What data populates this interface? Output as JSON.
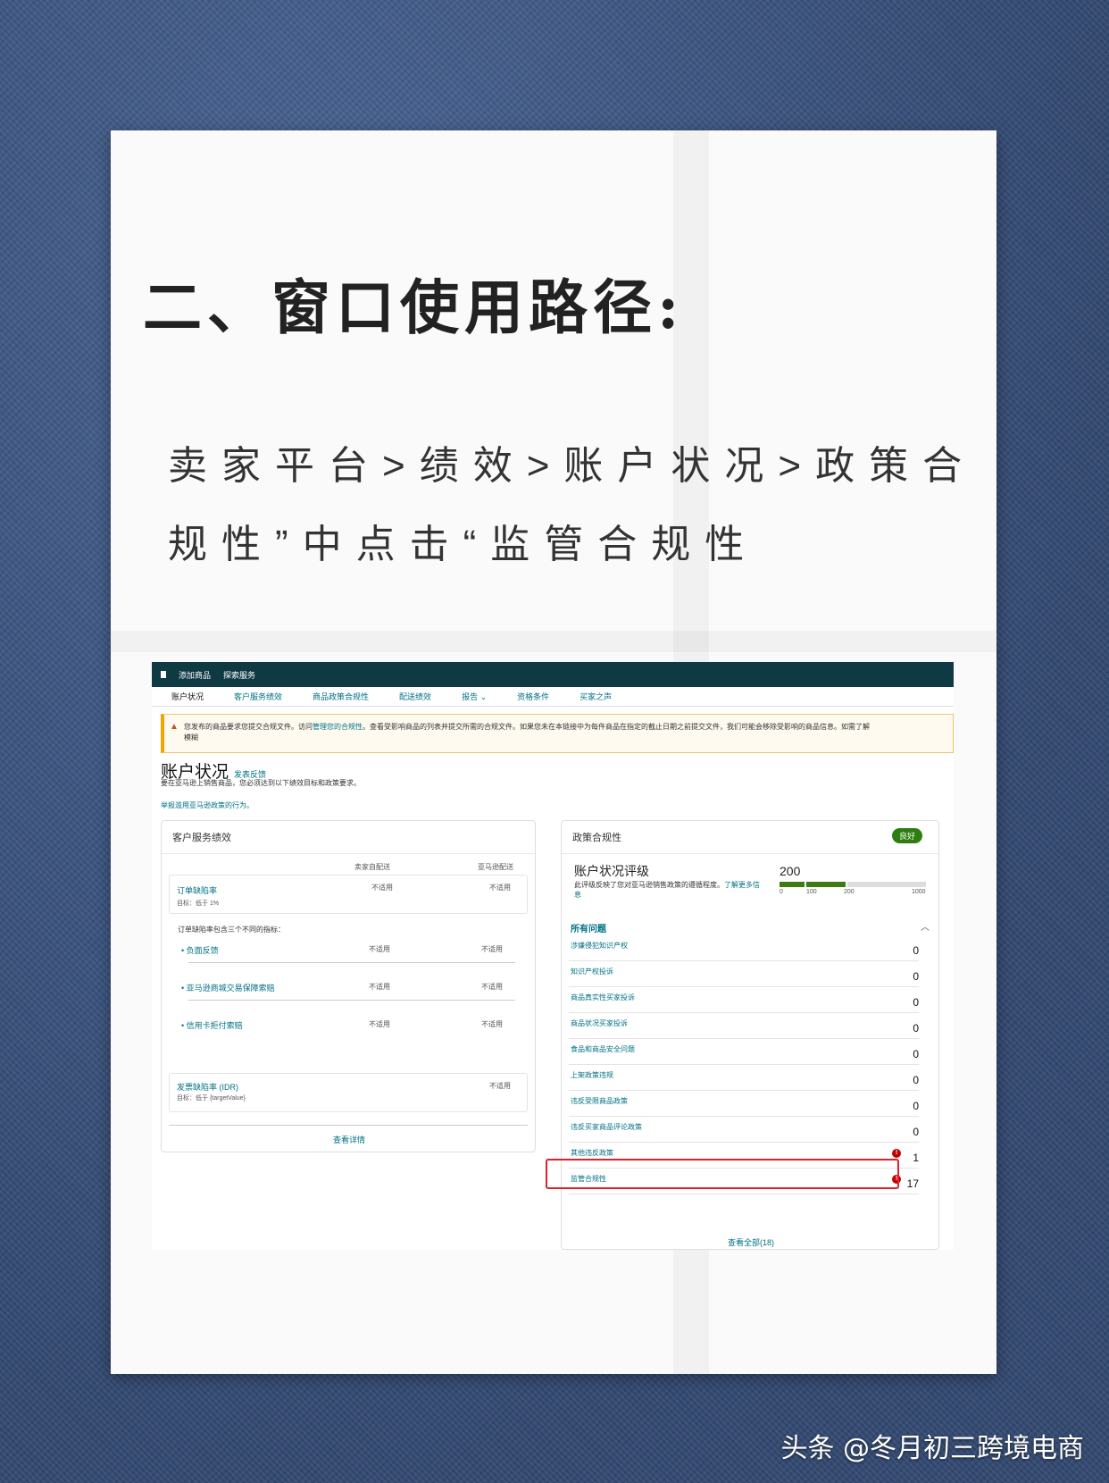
{
  "heading": "二、窗口使用路径:",
  "path_lines": [
    "卖家平台>绩效>账户状况>政策合",
    "规性”中点击“监管合规性"
  ],
  "screenshot": {
    "topbar": [
      "添加商品",
      "探索服务"
    ],
    "tabs": [
      "账户状况",
      "客户服务绩效",
      "商品政策合规性",
      "配送绩效",
      "报告 ⌄",
      "资格条件",
      "买家之声"
    ],
    "alert": {
      "text1": "您发布的商品要求您提交合规文件。访问",
      "link": "管理您的合规性",
      "text2": "。查看受影响商品的列表并提交所需的合规文件。如果您未在本链接中为每件商品在指定的截止日期之前提交文件，我们可能会移除受影响的商品信息。如需了解",
      "line2": "模糊"
    },
    "title": "账户状况",
    "feedback": "发表反馈",
    "subtitle": "要在亚马逊上销售商品，您必须达到以下绩效目标和政策要求。",
    "report_link": "举报滥用亚马逊政策的行为。",
    "left": {
      "title": "客户服务绩效",
      "col1": "卖家自配送",
      "col2": "亚马逊配送",
      "odr_label": "订单缺陷率",
      "odr_target": "目标：低于 1%",
      "na": "不适用",
      "includes": "订单缺陷率包含三个不同的指标：",
      "sub": [
        "• 负面反馈",
        "• 亚马逊商城交易保障索赔",
        "• 信用卡拒付索赔"
      ],
      "idr_label": "发票缺陷率 (IDR)",
      "idr_target": "目标：低于 {targetValue}",
      "see_detail": "查看详情"
    },
    "right": {
      "title": "政策合规性",
      "badge": "良好",
      "rating_title": "账户状况评级",
      "rating_desc": "此评级反映了您对亚马逊销售政策的遵循程度。",
      "rating_link": "了解更多信息",
      "score": "200",
      "ticks": [
        "0",
        "100",
        "200",
        "1000"
      ],
      "issues_head": "所有问题",
      "issues": [
        {
          "label": "涉嫌侵犯知识产权",
          "count": "0"
        },
        {
          "label": "知识产权投诉",
          "count": "0"
        },
        {
          "label": "商品真实性买家投诉",
          "count": "0"
        },
        {
          "label": "商品状况买家投诉",
          "count": "0"
        },
        {
          "label": "食品和商品安全问题",
          "count": "0"
        },
        {
          "label": "上架政策违规",
          "count": "0"
        },
        {
          "label": "违反受限商品政策",
          "count": "0"
        },
        {
          "label": "违反买家商品评论政策",
          "count": "0"
        },
        {
          "label": "其他违反政策",
          "count": "1"
        },
        {
          "label": "监管合规性",
          "count": "17"
        }
      ],
      "see_all": "查看全部(18)"
    }
  },
  "credit": "头条 @冬月初三跨境电商",
  "colors": {
    "nav": "#0f3a44",
    "link": "#007185",
    "highlight": "#e0202a",
    "good": "#2e7d0f"
  }
}
